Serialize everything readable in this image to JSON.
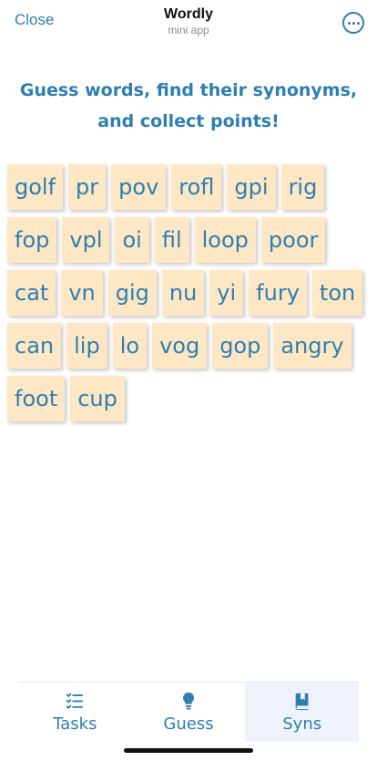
{
  "header": {
    "close_label": "Close",
    "title": "Wordly",
    "subtitle": "mini app",
    "more_icon": "ellipsis-circle-icon"
  },
  "headline": {
    "line1": "Guess words, find their synonyms,",
    "line2": "and collect points!"
  },
  "words": [
    "golf",
    "pr",
    "pov",
    "rofl",
    "gpi",
    "rig",
    "fop",
    "vpl",
    "oi",
    "fil",
    "loop",
    "poor",
    "cat",
    "vn",
    "gig",
    "nu",
    "yi",
    "fury",
    "ton",
    "can",
    "lip",
    "lo",
    "vog",
    "gop",
    "angry",
    "foot",
    "cup"
  ],
  "colors": {
    "accent": "#2e7fb0",
    "tile_background": "#fde7c4",
    "active_tab_background": "#eef3fb"
  },
  "tabs": [
    {
      "label": "Tasks",
      "icon": "checklist-icon",
      "active": false
    },
    {
      "label": "Guess",
      "icon": "lightbulb-icon",
      "active": false
    },
    {
      "label": "Syns",
      "icon": "bookmark-book-icon",
      "active": true
    }
  ]
}
